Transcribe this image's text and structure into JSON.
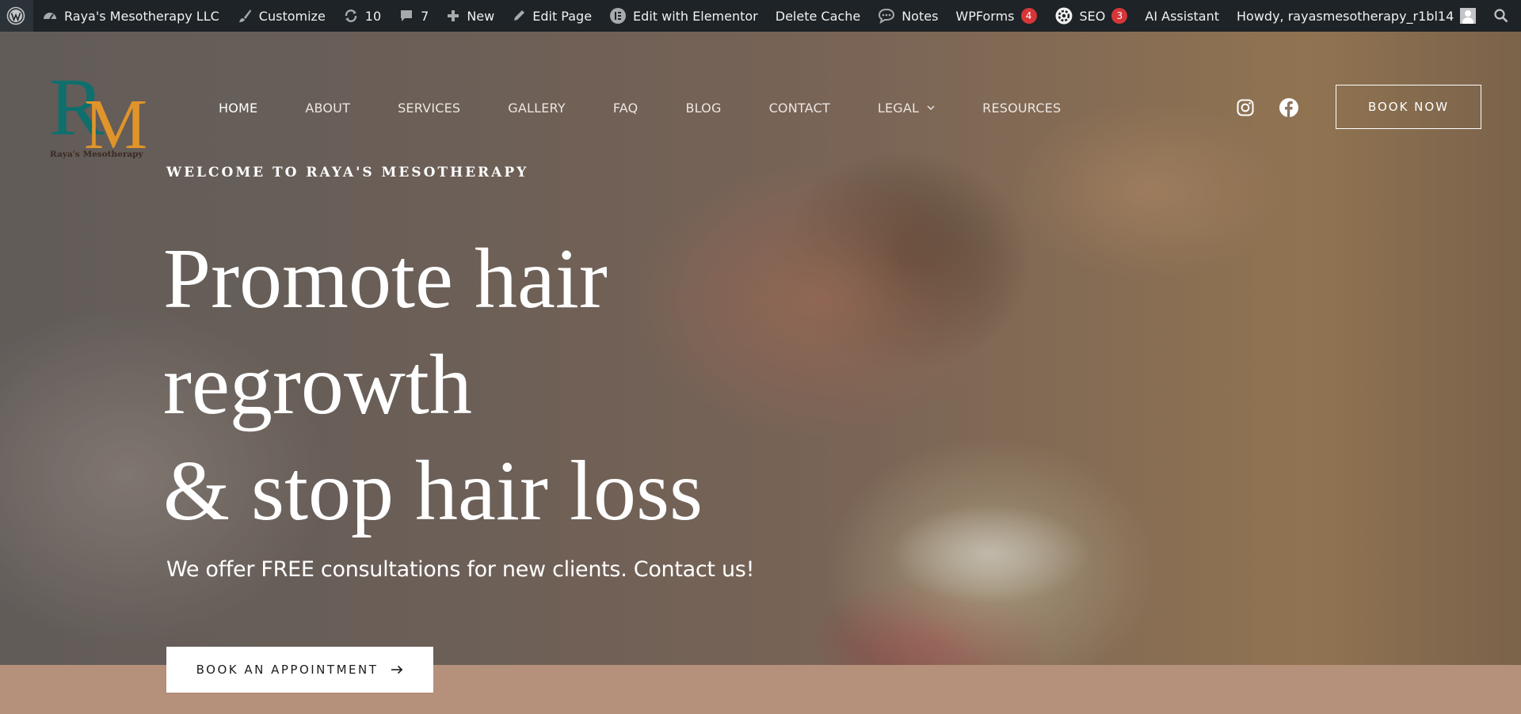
{
  "admin_bar": {
    "items": [
      {
        "label": "Raya's Mesotherapy LLC"
      },
      {
        "label": "Customize"
      },
      {
        "label": "10"
      },
      {
        "label": "7"
      },
      {
        "label": "New"
      },
      {
        "label": "Edit Page"
      },
      {
        "label": "Edit with Elementor"
      },
      {
        "label": "Delete Cache"
      },
      {
        "label": "Notes"
      },
      {
        "label": "WPForms",
        "badge": "4"
      },
      {
        "label": "SEO",
        "badge": "3"
      }
    ],
    "ai_assistant": "AI Assistant",
    "howdy": "Howdy, rayasmesotherapy_r1bl14"
  },
  "logo": {
    "monogram": "RM",
    "name": "Raya's Mesotherapy"
  },
  "nav": {
    "items": [
      "HOME",
      "ABOUT",
      "SERVICES",
      "GALLERY",
      "FAQ",
      "BLOG",
      "CONTACT",
      "LEGAL",
      "RESOURCES"
    ],
    "active": "HOME"
  },
  "header": {
    "book_now": "BOOK NOW"
  },
  "hero": {
    "eyebrow": "WELCOME TO RAYA'S MESOTHERAPY",
    "headline_lines": [
      "Promote hair",
      "regrowth",
      "& stop hair loss"
    ],
    "subtext": "We offer FREE consultations for new clients. Contact us!",
    "cta": "BOOK AN APPOINTMENT"
  },
  "colors": {
    "admin_bar_bg": "#1d2327",
    "logo_teal": "#0e6f6d",
    "logo_orange": "#e0942a",
    "strip_bg": "#b5907b",
    "badge_red": "#d63638"
  },
  "icons": {
    "admin_bar": [
      "wordpress-logo-icon",
      "dashboard-icon",
      "brush-icon",
      "update-icon",
      "comment-icon",
      "plus-icon",
      "pencil-icon",
      "elementor-icon",
      "notes-icon",
      "seo-icon",
      "search-icon"
    ],
    "social": [
      "instagram-icon",
      "facebook-icon"
    ],
    "cta": "arrow-right-icon"
  }
}
